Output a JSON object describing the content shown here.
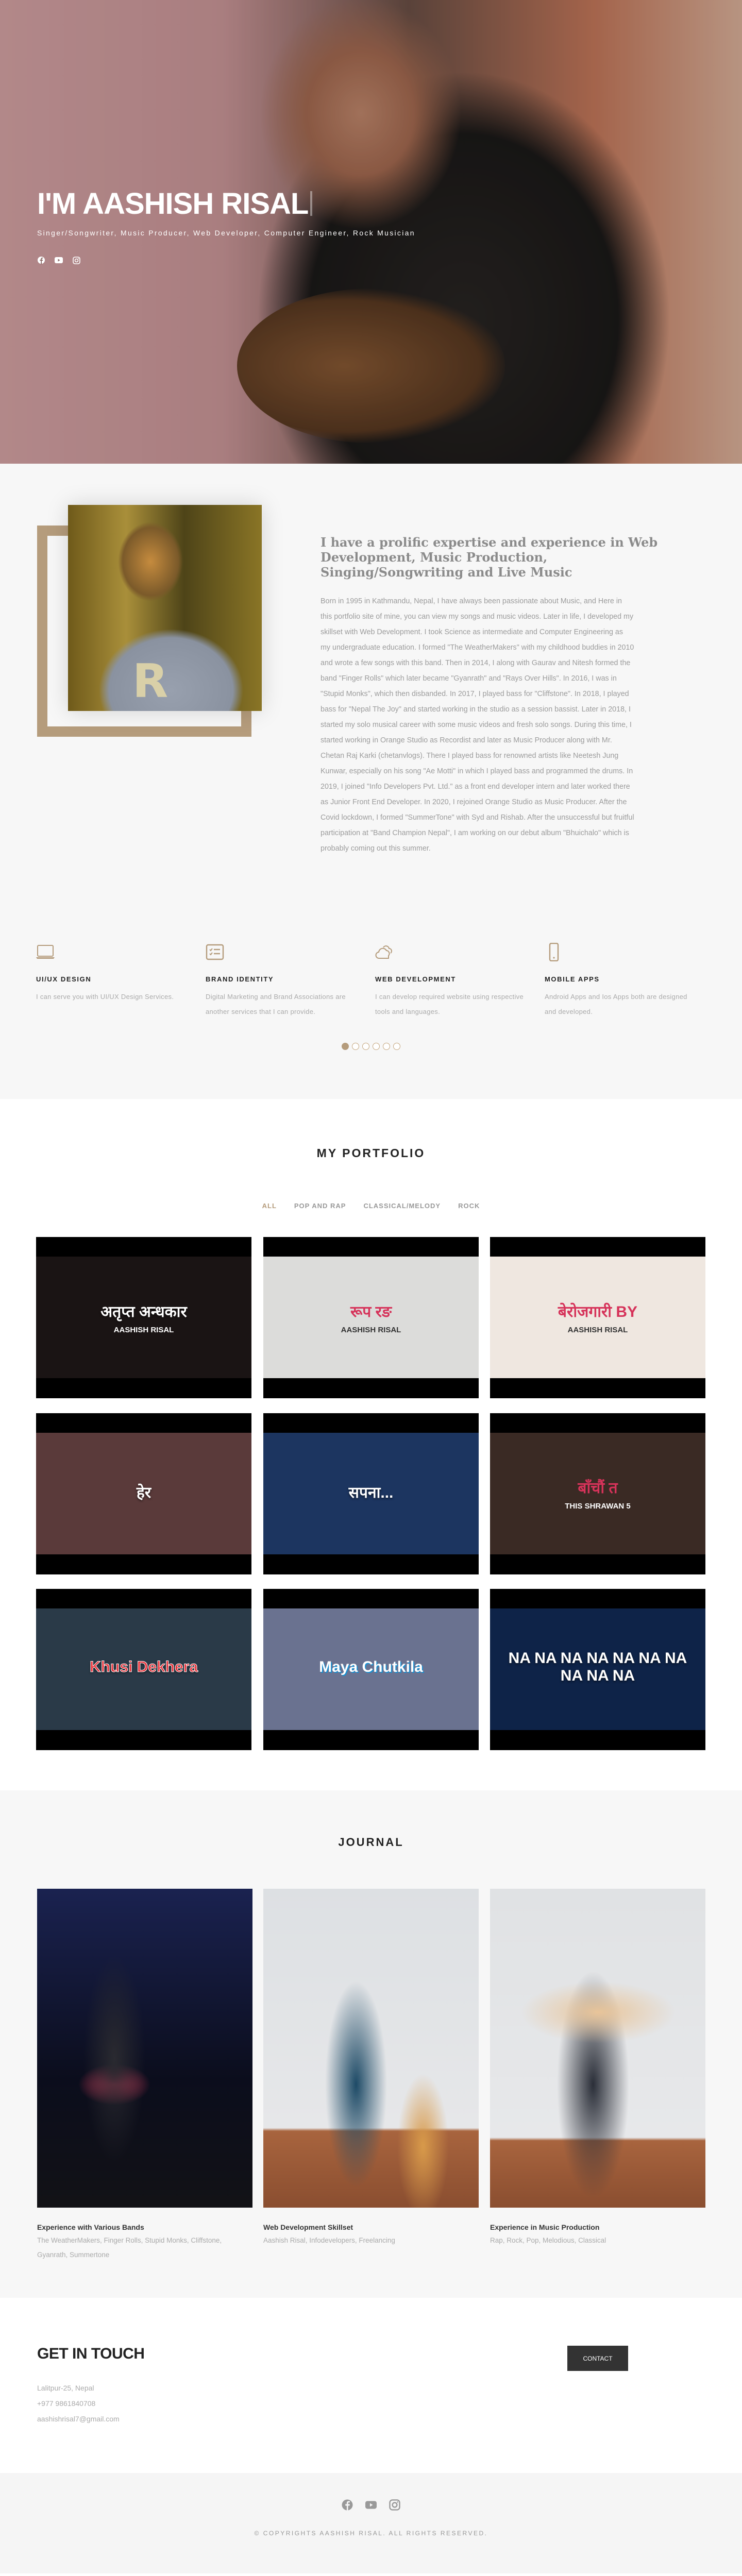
{
  "hero": {
    "title": "I'M AASHISH RISAL",
    "subtitle": "Singer/Songwriter, Music Producer, Web Developer, Computer Engineer, Rock Musician",
    "social": [
      "facebook-icon",
      "youtube-icon",
      "instagram-icon"
    ]
  },
  "about": {
    "heading": "I have a prolific expertise and experience in Web Development, Music Production, Singing/Songwriting and Live Music",
    "body": "Born in 1995 in Kathmandu, Nepal, I have always been passionate about Music, and Here in this portfolio site of mine, you can view my songs and music videos. Later in life, I developed my skillset with Web Development. I took Science as intermediate and Computer Engineering as my undergraduate education. I formed \"The WeatherMakers\" with my childhood buddies in 2010 and wrote a few songs with this band. Then in 2014, I along with Gaurav and Nitesh formed the band \"Finger Rolls\" which later became \"Gyanrath\" and \"Rays Over Hills\". In 2016, I was in \"Stupid Monks\", which then disbanded. In 2017, I played bass for \"Cliffstone\". In 2018, I played bass for \"Nepal The Joy\" and started working in the studio as a session bassist. Later in 2018, I started my solo musical career with some music videos and fresh solo songs. During this time, I started working in Orange Studio as Recordist and later as Music Producer along with Mr. Chetan Raj Karki (chetanvlogs). There I played bass for renowned artists like Neetesh Jung Kunwar, especially on his song \"Ae Motti\" in which I played bass and programmed the drums. In 2019, I joined \"Info Developers Pvt. Ltd.\" as a front end developer intern and later worked there as Junior Front End Developer. In 2020, I rejoined Orange Studio as Music Producer. After the Covid lockdown, I formed \"SummerTone\" with Syd and Rishab. After the unsuccessful but fruitful participation at \"Band Champion Nepal\", I am working on our debut album \"Bhuichalo\" which is probably coming out this summer.",
    "services": [
      {
        "icon": "laptop-icon",
        "title": "UI/UX DESIGN",
        "desc": "I can serve you with UI/UX Design Services."
      },
      {
        "icon": "checklist-icon",
        "title": "BRAND IDENTITY",
        "desc": "Digital Marketing and Brand Associations are another services that I can provide."
      },
      {
        "icon": "cloud-icon",
        "title": "WEB DEVELOPMENT",
        "desc": "I can develop required website using respective tools and languages."
      },
      {
        "icon": "mobile-icon",
        "title": "MOBILE APPS",
        "desc": "Android Apps and Ios Apps both are designed and developed."
      }
    ],
    "slider": {
      "pages": 6,
      "active": 1
    }
  },
  "portfolio": {
    "title": "MY PORTFOLIO",
    "filters": [
      "ALL",
      "POP AND RAP",
      "CLASSICAL/MELODY",
      "ROCK"
    ],
    "active_filter": "ALL",
    "items": [
      {
        "title": "अतृप्त अन्धकार",
        "artist": "AASHISH RISAL",
        "bg": "#1a1414"
      },
      {
        "title": "रूप रङ",
        "artist": "AASHISH RISAL",
        "bg": "#dcdcda"
      },
      {
        "title": "बेरोजगारी BY",
        "artist": "AASHISH RISAL",
        "bg": "#efe7e0"
      },
      {
        "title": "हेर",
        "artist": "",
        "bg": "#5a3a3a"
      },
      {
        "title": "सपना...",
        "artist": "",
        "bg": "#1c3560"
      },
      {
        "title": "बाँचौं त",
        "artist": "THIS SHRAWAN 5",
        "bg": "#3a2a24"
      },
      {
        "title": "Khusi Dekhera",
        "artist": "",
        "bg": "#2a3a48"
      },
      {
        "title": "Maya Chutkila",
        "artist": "",
        "bg": "#6a7290"
      },
      {
        "title": "NA NA NA NA NA NA NA NA NA NA",
        "artist": "",
        "bg": "#0e2348"
      }
    ]
  },
  "journal": {
    "title": "JOURNAL",
    "items": [
      {
        "title": "Experience with Various Bands",
        "desc": "The WeatherMakers, Finger Rolls, Stupid Monks, Cliffstone, Gyanrath, Summertone"
      },
      {
        "title": "Web Development Skillset",
        "desc": "Aashish Risal, Infodevelopers, Freelancing"
      },
      {
        "title": "Experience in Music Production",
        "desc": "Rap, Rock, Pop, Melodious, Classical"
      }
    ]
  },
  "contact": {
    "title": "GET IN TOUCH",
    "button": "CONTACT",
    "address": "Lalitpur-25, Nepal",
    "phone": "+977 9861840708",
    "email": "aashishrisal7@gmail.com"
  },
  "footer": {
    "copyright": "© COPYRIGHTS AASHISH RISAL. ALL RIGHTS RESERVED."
  },
  "colors": {
    "accent": "#b59c7c",
    "dark": "#333333",
    "light_bg": "#f7f7f7"
  }
}
